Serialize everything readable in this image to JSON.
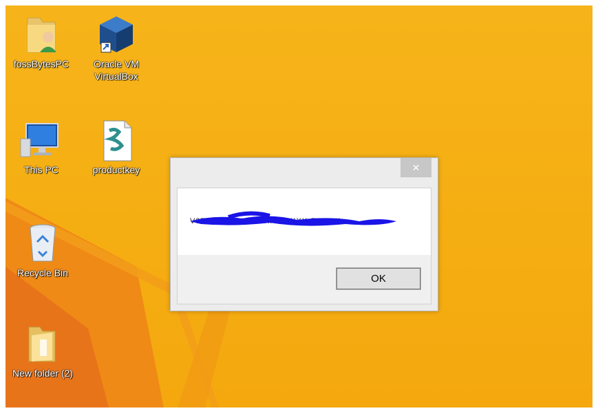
{
  "desktop": {
    "icons": [
      {
        "label": "fossBytesPC",
        "icon": "user-folder-icon"
      },
      {
        "label": "Oracle VM VirtualBox",
        "icon": "virtualbox-icon"
      },
      {
        "label": "This PC",
        "icon": "computer-icon"
      },
      {
        "label": "productkey",
        "icon": "script-file-icon"
      },
      {
        "label": "Recycle Bin",
        "icon": "recycle-bin-icon"
      },
      {
        "label": "New folder (2)",
        "icon": "folder-icon"
      }
    ],
    "accent_color": "#f5ae12"
  },
  "dialog": {
    "close_glyph": "✕",
    "message": "V3TH-XXXXX-XXXXX-XXXXX-FHDGK",
    "ok_label": "OK"
  }
}
